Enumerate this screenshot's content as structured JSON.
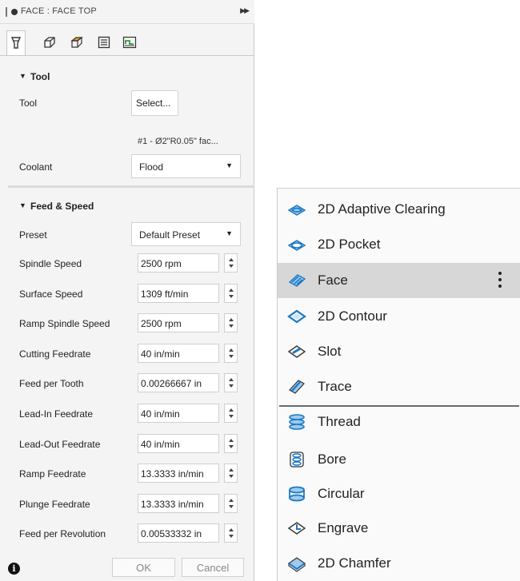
{
  "dialog": {
    "title": "FACE : FACE TOP",
    "tabs": [
      {
        "name": "tool-tab",
        "icon": "tool-holder-icon"
      },
      {
        "name": "geometry-tab",
        "icon": "geometry-box-icon"
      },
      {
        "name": "heights-tab",
        "icon": "heights-box-icon"
      },
      {
        "name": "passes-tab",
        "icon": "passes-list-icon"
      },
      {
        "name": "linking-tab",
        "icon": "linking-icon"
      }
    ],
    "tool_section": {
      "header": "Tool",
      "tool_label": "Tool",
      "select_label": "Select...",
      "tool_description": "#1 - Ø2\"R0.05\" fac...",
      "coolant_label": "Coolant",
      "coolant_value": "Flood"
    },
    "feed_section": {
      "header": "Feed & Speed",
      "preset_label": "Preset",
      "preset_value": "Default Preset",
      "fields": [
        {
          "label": "Spindle Speed",
          "value": "2500 rpm"
        },
        {
          "label": "Surface Speed",
          "value": "1309 ft/min"
        },
        {
          "label": "Ramp Spindle Speed",
          "value": "2500 rpm"
        },
        {
          "label": "Cutting Feedrate",
          "value": "40 in/min"
        },
        {
          "label": "Feed per Tooth",
          "value": "0.00266667 in"
        },
        {
          "label": "Lead-In Feedrate",
          "value": "40 in/min"
        },
        {
          "label": "Lead-Out Feedrate",
          "value": "40 in/min"
        },
        {
          "label": "Ramp Feedrate",
          "value": "13.3333 in/min"
        },
        {
          "label": "Plunge Feedrate",
          "value": "13.3333 in/min"
        },
        {
          "label": "Feed per Revolution",
          "value": "0.00533332 in"
        }
      ]
    },
    "footer": {
      "ok_label": "OK",
      "cancel_label": "Cancel"
    }
  },
  "menu": {
    "items": [
      {
        "label": "2D Adaptive Clearing",
        "icon": "adaptive-clearing-icon"
      },
      {
        "label": "2D Pocket",
        "icon": "pocket-icon"
      },
      {
        "label": "Face",
        "icon": "face-icon",
        "highlighted": true
      },
      {
        "label": "2D Contour",
        "icon": "contour-icon"
      },
      {
        "label": "Slot",
        "icon": "slot-icon"
      },
      {
        "label": "Trace",
        "icon": "trace-icon"
      },
      {
        "label": "Thread",
        "icon": "thread-icon"
      },
      {
        "label": "Bore",
        "icon": "bore-icon"
      },
      {
        "label": "Circular",
        "icon": "circular-icon"
      },
      {
        "label": "Engrave",
        "icon": "engrave-icon"
      },
      {
        "label": "2D Chamfer",
        "icon": "chamfer-icon"
      }
    ]
  },
  "colors": {
    "icon_blue": "#1c78c4",
    "highlight": "#d7d7d7"
  }
}
